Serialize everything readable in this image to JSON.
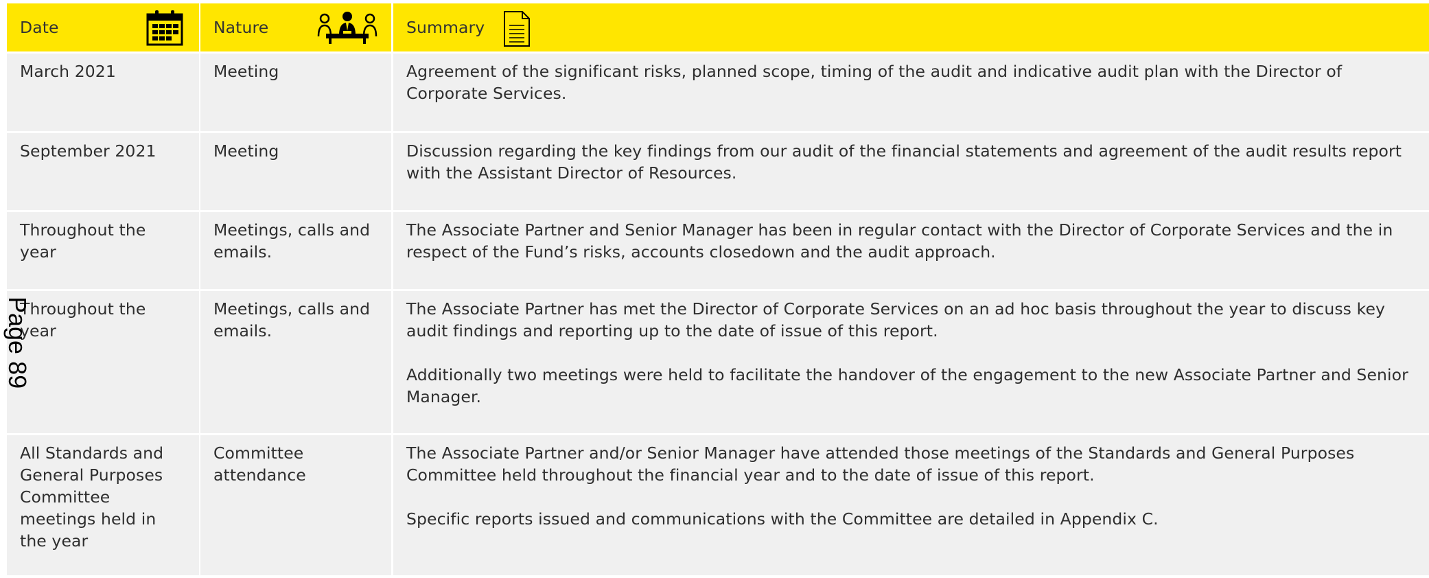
{
  "table": {
    "headers": {
      "date": "Date",
      "nature": "Nature",
      "summary": "Summary"
    },
    "header_icons": {
      "date": "calendar-icon",
      "nature": "meeting-people-icon",
      "summary": "document-icon"
    },
    "colors": {
      "header_bg": "#ffe600",
      "row_bg": "#f0f0f0"
    },
    "rows": [
      {
        "date": "March 2021",
        "nature": "Meeting",
        "summary": [
          "Agreement of the significant risks, planned scope, timing of the audit and indicative audit plan with the Director of Corporate Services."
        ]
      },
      {
        "date": "September 2021",
        "nature": "Meeting",
        "summary": [
          "Discussion regarding the key findings from our audit of the financial statements and agreement of the audit results report with the Assistant Director of Resources."
        ]
      },
      {
        "date": "Throughout the year",
        "nature": "Meetings, calls and emails.",
        "summary": [
          "The Associate Partner and Senior Manager has been in regular contact with the Director of Corporate Services and the in respect of the Fund’s risks, accounts closedown and the audit approach."
        ]
      },
      {
        "date": "Throughout the year",
        "nature": "Meetings, calls and emails.",
        "summary": [
          "The Associate Partner has met the Director of Corporate Services on an ad hoc basis throughout the year to discuss key audit findings and reporting up to the date of issue of this report.",
          "Additionally two meetings were held to facilitate the handover of the engagement to the new Associate Partner and Senior Manager."
        ]
      },
      {
        "date": "All Standards and General Purposes Committee meetings held in the year",
        "nature": "Committee attendance",
        "summary": [
          "The Associate Partner and/or Senior Manager have attended those meetings of the Standards and General Purposes Committee held throughout the financial year and to the date of issue of this report.",
          "Specific reports issued and communications with the Committee are detailed in Appendix C."
        ]
      }
    ]
  },
  "page_stamp": "Page 89"
}
